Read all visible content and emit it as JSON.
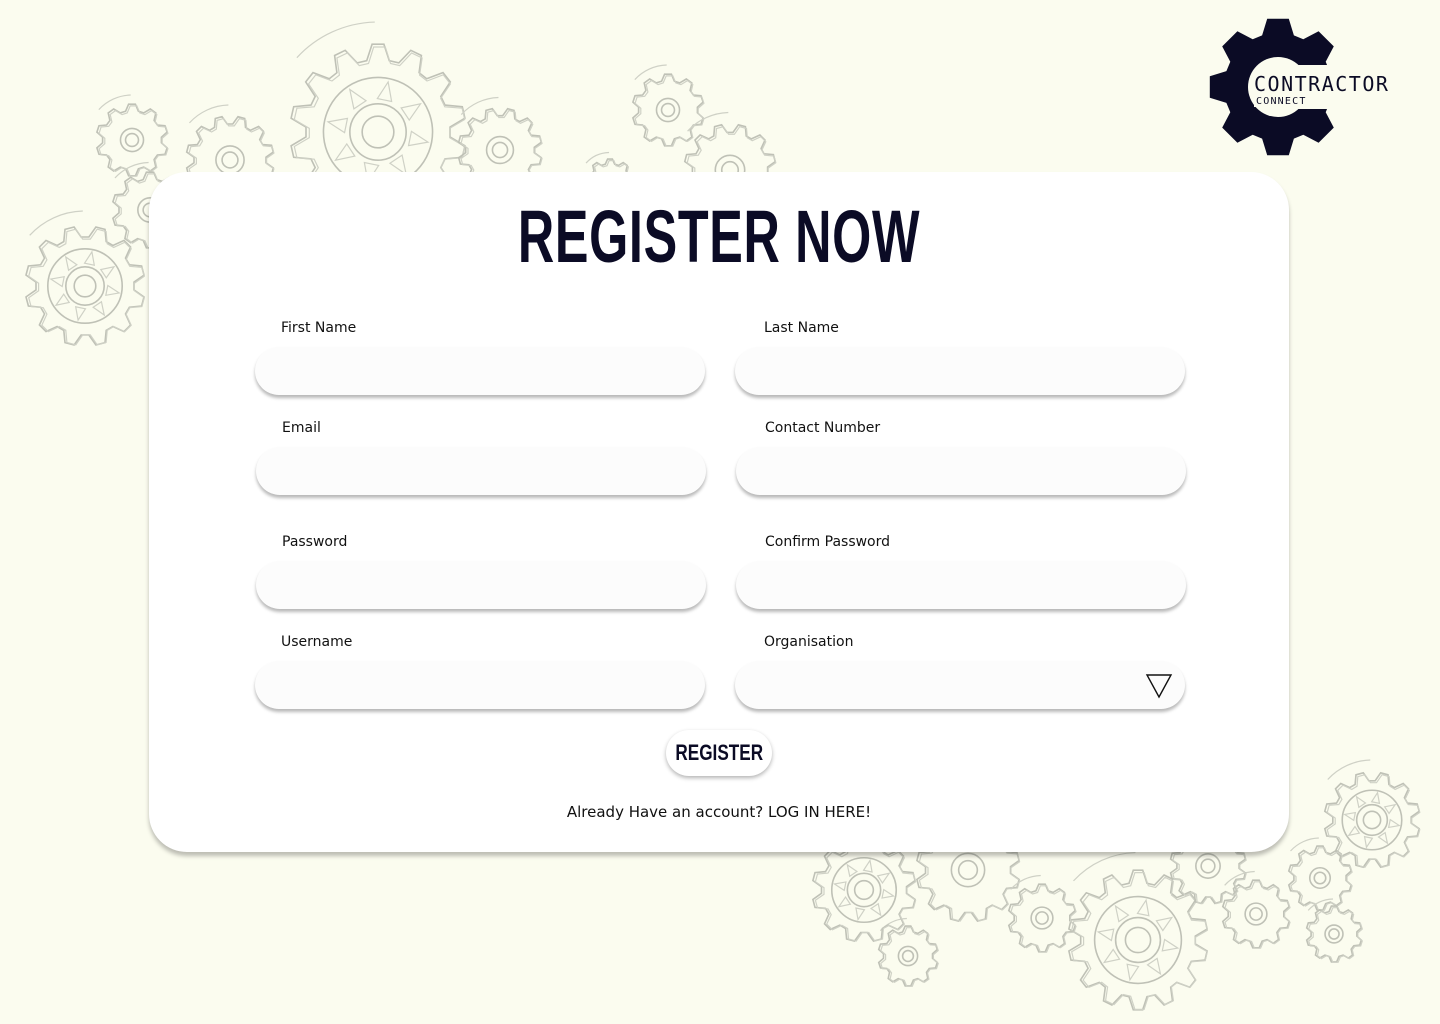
{
  "logo": {
    "name_main": "CONTRACTOR",
    "name_sub": "CONNECT",
    "icon": "gear-icon",
    "color": "#0b0b25"
  },
  "colors": {
    "background": "#fbfcef",
    "card": "#ffffff",
    "title": "#0b0b25",
    "gear_sketch": "#bfc1b6"
  },
  "form": {
    "title": "REGISTER NOW",
    "fields": {
      "first_name": {
        "label": "First Name",
        "value": "",
        "placeholder": ""
      },
      "last_name": {
        "label": "Last Name",
        "value": "",
        "placeholder": ""
      },
      "email": {
        "label": "Email",
        "value": "",
        "placeholder": ""
      },
      "contact_number": {
        "label": "Contact Number",
        "value": "",
        "placeholder": ""
      },
      "password": {
        "label": "Password",
        "value": "",
        "placeholder": ""
      },
      "confirm_password": {
        "label": "Confirm Password",
        "value": "",
        "placeholder": ""
      },
      "username": {
        "label": "Username",
        "value": "",
        "placeholder": ""
      },
      "organisation": {
        "label": "Organisation",
        "value": "",
        "icon": "triangle-down-icon"
      }
    },
    "register_label": "REGISTER",
    "login_prompt": "Already Have an account?",
    "login_link": "LOG IN HERE!"
  }
}
